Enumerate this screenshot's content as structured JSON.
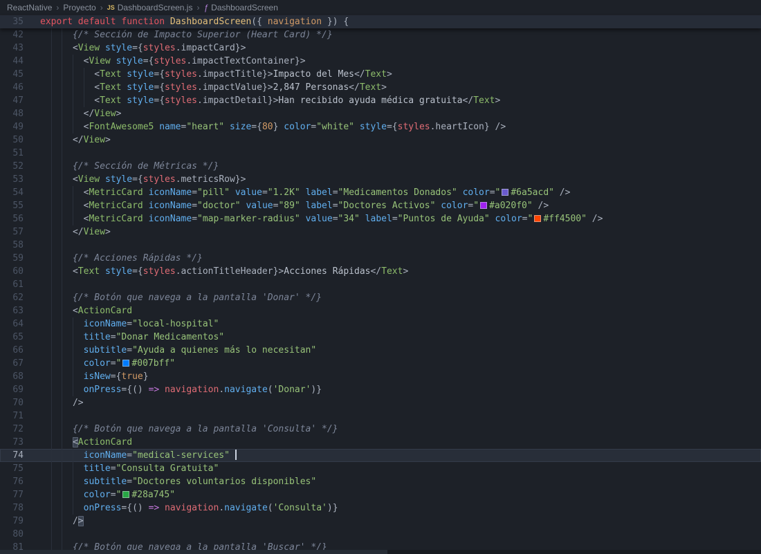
{
  "breadcrumb": {
    "separator": "›",
    "icons": {
      "js": "JS",
      "function": "ƒ"
    },
    "items": [
      {
        "label": "ReactNative"
      },
      {
        "label": "Proyecto"
      },
      {
        "label": "DashboardScreen.js",
        "icon": "js"
      },
      {
        "label": "DashboardScreen",
        "icon": "function"
      }
    ]
  },
  "editor": {
    "current_line": 74,
    "swatch_colors": [
      "#6a5acd",
      "#a020f0",
      "#ff4500",
      "#007bff",
      "#28a745"
    ],
    "sticky_line": {
      "num": 35,
      "tokens": [
        [
          "k",
          "export"
        ],
        [
          "p",
          " "
        ],
        [
          "k",
          "default"
        ],
        [
          "p",
          " "
        ],
        [
          "k",
          "function"
        ],
        [
          "p",
          " "
        ],
        [
          "f",
          "DashboardScreen"
        ],
        [
          "p",
          "({ "
        ],
        [
          "m",
          "navigation"
        ],
        [
          "p",
          " }) {"
        ]
      ]
    },
    "lines": [
      {
        "num": 42,
        "tokens": [
          [
            "c",
            "      {/* Sección de Impacto Superior (Heart Card) */}"
          ]
        ]
      },
      {
        "num": 43,
        "tokens": [
          [
            "p",
            "      <"
          ],
          [
            "t",
            "View"
          ],
          [
            "p",
            " "
          ],
          [
            "a",
            "style"
          ],
          [
            "p",
            "={"
          ],
          [
            "v",
            "styles"
          ],
          [
            "p",
            ".impactCard"
          ],
          [
            "p",
            "}>"
          ]
        ]
      },
      {
        "num": 44,
        "tokens": [
          [
            "p",
            "        <"
          ],
          [
            "t",
            "View"
          ],
          [
            "p",
            " "
          ],
          [
            "a",
            "style"
          ],
          [
            "p",
            "={"
          ],
          [
            "v",
            "styles"
          ],
          [
            "p",
            ".impactTextContainer"
          ],
          [
            "p",
            "}>"
          ]
        ]
      },
      {
        "num": 45,
        "tokens": [
          [
            "p",
            "          <"
          ],
          [
            "t",
            "Text"
          ],
          [
            "p",
            " "
          ],
          [
            "a",
            "style"
          ],
          [
            "p",
            "={"
          ],
          [
            "v",
            "styles"
          ],
          [
            "p",
            ".impactTitle"
          ],
          [
            "p",
            "}>"
          ],
          [
            "x",
            "Impacto del Mes"
          ],
          [
            "p",
            "</"
          ],
          [
            "t",
            "Text"
          ],
          [
            "p",
            ">"
          ]
        ]
      },
      {
        "num": 46,
        "tokens": [
          [
            "p",
            "          <"
          ],
          [
            "t",
            "Text"
          ],
          [
            "p",
            " "
          ],
          [
            "a",
            "style"
          ],
          [
            "p",
            "={"
          ],
          [
            "v",
            "styles"
          ],
          [
            "p",
            ".impactValue"
          ],
          [
            "p",
            "}>"
          ],
          [
            "x",
            "2,847 Personas"
          ],
          [
            "p",
            "</"
          ],
          [
            "t",
            "Text"
          ],
          [
            "p",
            ">"
          ]
        ]
      },
      {
        "num": 47,
        "tokens": [
          [
            "p",
            "          <"
          ],
          [
            "t",
            "Text"
          ],
          [
            "p",
            " "
          ],
          [
            "a",
            "style"
          ],
          [
            "p",
            "={"
          ],
          [
            "v",
            "styles"
          ],
          [
            "p",
            ".impactDetail"
          ],
          [
            "p",
            "}>"
          ],
          [
            "x",
            "Han recibido ayuda médica gratuita"
          ],
          [
            "p",
            "</"
          ],
          [
            "t",
            "Text"
          ],
          [
            "p",
            ">"
          ]
        ]
      },
      {
        "num": 48,
        "tokens": [
          [
            "p",
            "        </"
          ],
          [
            "t",
            "View"
          ],
          [
            "p",
            ">"
          ]
        ]
      },
      {
        "num": 49,
        "tokens": [
          [
            "p",
            "        <"
          ],
          [
            "t",
            "FontAwesome5"
          ],
          [
            "p",
            " "
          ],
          [
            "a",
            "name"
          ],
          [
            "p",
            "="
          ],
          [
            "s",
            "\"heart\""
          ],
          [
            "p",
            " "
          ],
          [
            "a",
            "size"
          ],
          [
            "p",
            "={"
          ],
          [
            "m",
            "80"
          ],
          [
            "p",
            "} "
          ],
          [
            "a",
            "color"
          ],
          [
            "p",
            "="
          ],
          [
            "s",
            "\"white\""
          ],
          [
            "p",
            " "
          ],
          [
            "a",
            "style"
          ],
          [
            "p",
            "={"
          ],
          [
            "v",
            "styles"
          ],
          [
            "p",
            ".heartIcon"
          ],
          [
            "p",
            "} />"
          ]
        ]
      },
      {
        "num": 50,
        "tokens": [
          [
            "p",
            "      </"
          ],
          [
            "t",
            "View"
          ],
          [
            "p",
            ">"
          ]
        ]
      },
      {
        "num": 51,
        "tokens": []
      },
      {
        "num": 52,
        "tokens": [
          [
            "c",
            "      {/* Sección de Métricas */}"
          ]
        ]
      },
      {
        "num": 53,
        "tokens": [
          [
            "p",
            "      <"
          ],
          [
            "t",
            "View"
          ],
          [
            "p",
            " "
          ],
          [
            "a",
            "style"
          ],
          [
            "p",
            "={"
          ],
          [
            "v",
            "styles"
          ],
          [
            "p",
            ".metricsRow"
          ],
          [
            "p",
            "}>"
          ]
        ]
      },
      {
        "num": 54,
        "tokens": [
          [
            "p",
            "        <"
          ],
          [
            "t",
            "MetricCard"
          ],
          [
            "p",
            " "
          ],
          [
            "a",
            "iconName"
          ],
          [
            "p",
            "="
          ],
          [
            "s",
            "\"pill\""
          ],
          [
            "p",
            " "
          ],
          [
            "a",
            "value"
          ],
          [
            "p",
            "="
          ],
          [
            "s",
            "\"1.2K\""
          ],
          [
            "p",
            " "
          ],
          [
            "a",
            "label"
          ],
          [
            "p",
            "="
          ],
          [
            "s",
            "\"Medicamentos Donados\""
          ],
          [
            "p",
            " "
          ],
          [
            "a",
            "color"
          ],
          [
            "p",
            "="
          ],
          [
            "s",
            "\""
          ],
          [
            "sw",
            "#6a5acd"
          ],
          [
            "s",
            "#6a5acd\""
          ],
          [
            "p",
            " />"
          ]
        ]
      },
      {
        "num": 55,
        "tokens": [
          [
            "p",
            "        <"
          ],
          [
            "t",
            "MetricCard"
          ],
          [
            "p",
            " "
          ],
          [
            "a",
            "iconName"
          ],
          [
            "p",
            "="
          ],
          [
            "s",
            "\"doctor\""
          ],
          [
            "p",
            " "
          ],
          [
            "a",
            "value"
          ],
          [
            "p",
            "="
          ],
          [
            "s",
            "\"89\""
          ],
          [
            "p",
            " "
          ],
          [
            "a",
            "label"
          ],
          [
            "p",
            "="
          ],
          [
            "s",
            "\"Doctores Activos\""
          ],
          [
            "p",
            " "
          ],
          [
            "a",
            "color"
          ],
          [
            "p",
            "="
          ],
          [
            "s",
            "\""
          ],
          [
            "sw",
            "#a020f0"
          ],
          [
            "s",
            "#a020f0\""
          ],
          [
            "p",
            " />"
          ]
        ]
      },
      {
        "num": 56,
        "tokens": [
          [
            "p",
            "        <"
          ],
          [
            "t",
            "MetricCard"
          ],
          [
            "p",
            " "
          ],
          [
            "a",
            "iconName"
          ],
          [
            "p",
            "="
          ],
          [
            "s",
            "\"map-marker-radius\""
          ],
          [
            "p",
            " "
          ],
          [
            "a",
            "value"
          ],
          [
            "p",
            "="
          ],
          [
            "s",
            "\"34\""
          ],
          [
            "p",
            " "
          ],
          [
            "a",
            "label"
          ],
          [
            "p",
            "="
          ],
          [
            "s",
            "\"Puntos de Ayuda\""
          ],
          [
            "p",
            " "
          ],
          [
            "a",
            "color"
          ],
          [
            "p",
            "="
          ],
          [
            "s",
            "\""
          ],
          [
            "sw",
            "#ff4500"
          ],
          [
            "s",
            "#ff4500\""
          ],
          [
            "p",
            " />"
          ]
        ]
      },
      {
        "num": 57,
        "tokens": [
          [
            "p",
            "      </"
          ],
          [
            "t",
            "View"
          ],
          [
            "p",
            ">"
          ]
        ]
      },
      {
        "num": 58,
        "tokens": []
      },
      {
        "num": 59,
        "tokens": [
          [
            "c",
            "      {/* Acciones Rápidas */}"
          ]
        ]
      },
      {
        "num": 60,
        "tokens": [
          [
            "p",
            "      <"
          ],
          [
            "t",
            "Text"
          ],
          [
            "p",
            " "
          ],
          [
            "a",
            "style"
          ],
          [
            "p",
            "={"
          ],
          [
            "v",
            "styles"
          ],
          [
            "p",
            ".actionTitleHeader"
          ],
          [
            "p",
            "}>"
          ],
          [
            "x",
            "Acciones Rápidas"
          ],
          [
            "p",
            "</"
          ],
          [
            "t",
            "Text"
          ],
          [
            "p",
            ">"
          ]
        ]
      },
      {
        "num": 61,
        "tokens": []
      },
      {
        "num": 62,
        "tokens": [
          [
            "c",
            "      {/* Botón que navega a la pantalla 'Donar' */}"
          ]
        ]
      },
      {
        "num": 63,
        "tokens": [
          [
            "p",
            "      <"
          ],
          [
            "t",
            "ActionCard"
          ]
        ]
      },
      {
        "num": 64,
        "tokens": [
          [
            "p",
            "        "
          ],
          [
            "a",
            "iconName"
          ],
          [
            "p",
            "="
          ],
          [
            "s",
            "\"local-hospital\""
          ]
        ]
      },
      {
        "num": 65,
        "tokens": [
          [
            "p",
            "        "
          ],
          [
            "a",
            "title"
          ],
          [
            "p",
            "="
          ],
          [
            "s",
            "\"Donar Medicamentos\""
          ]
        ]
      },
      {
        "num": 66,
        "tokens": [
          [
            "p",
            "        "
          ],
          [
            "a",
            "subtitle"
          ],
          [
            "p",
            "="
          ],
          [
            "s",
            "\"Ayuda a quienes más lo necesitan\""
          ]
        ]
      },
      {
        "num": 67,
        "tokens": [
          [
            "p",
            "        "
          ],
          [
            "a",
            "color"
          ],
          [
            "p",
            "="
          ],
          [
            "s",
            "\""
          ],
          [
            "sw",
            "#007bff"
          ],
          [
            "s",
            "#007bff\""
          ]
        ]
      },
      {
        "num": 68,
        "tokens": [
          [
            "p",
            "        "
          ],
          [
            "a",
            "isNew"
          ],
          [
            "p",
            "={"
          ],
          [
            "m",
            "true"
          ],
          [
            "p",
            "}"
          ]
        ]
      },
      {
        "num": 69,
        "tokens": [
          [
            "p",
            "        "
          ],
          [
            "a",
            "onPress"
          ],
          [
            "p",
            "={() "
          ],
          [
            "o",
            "=>"
          ],
          [
            "p",
            " "
          ],
          [
            "v",
            "navigation"
          ],
          [
            "p",
            "."
          ],
          [
            "b",
            "navigate"
          ],
          [
            "p",
            "("
          ],
          [
            "s",
            "'Donar'"
          ],
          [
            "p",
            ")}"
          ]
        ]
      },
      {
        "num": 70,
        "tokens": [
          [
            "p",
            "      />"
          ]
        ]
      },
      {
        "num": 71,
        "tokens": []
      },
      {
        "num": 72,
        "tokens": [
          [
            "c",
            "      {/* Botón que navega a la pantalla 'Consulta' */}"
          ]
        ]
      },
      {
        "num": 73,
        "tokens": [
          [
            "p",
            "      "
          ],
          [
            "p bm",
            "<"
          ],
          [
            "t",
            "ActionCard"
          ]
        ]
      },
      {
        "num": 74,
        "current": true,
        "tokens": [
          [
            "p",
            "        "
          ],
          [
            "a",
            "iconName"
          ],
          [
            "p",
            "="
          ],
          [
            "s",
            "\"medical-services\""
          ],
          [
            "p",
            " "
          ],
          [
            "cur",
            ""
          ]
        ]
      },
      {
        "num": 75,
        "tokens": [
          [
            "p",
            "        "
          ],
          [
            "a",
            "title"
          ],
          [
            "p",
            "="
          ],
          [
            "s",
            "\"Consulta Gratuita\""
          ]
        ]
      },
      {
        "num": 76,
        "tokens": [
          [
            "p",
            "        "
          ],
          [
            "a",
            "subtitle"
          ],
          [
            "p",
            "="
          ],
          [
            "s",
            "\"Doctores voluntarios disponibles\""
          ]
        ]
      },
      {
        "num": 77,
        "tokens": [
          [
            "p",
            "        "
          ],
          [
            "a",
            "color"
          ],
          [
            "p",
            "="
          ],
          [
            "s",
            "\""
          ],
          [
            "sw",
            "#28a745"
          ],
          [
            "s",
            "#28a745\""
          ]
        ]
      },
      {
        "num": 78,
        "tokens": [
          [
            "p",
            "        "
          ],
          [
            "a",
            "onPress"
          ],
          [
            "p",
            "={() "
          ],
          [
            "o",
            "=>"
          ],
          [
            "p",
            " "
          ],
          [
            "v",
            "navigation"
          ],
          [
            "p",
            "."
          ],
          [
            "b",
            "navigate"
          ],
          [
            "p",
            "("
          ],
          [
            "s",
            "'Consulta'"
          ],
          [
            "p",
            ")}"
          ]
        ]
      },
      {
        "num": 79,
        "tokens": [
          [
            "p",
            "      /"
          ],
          [
            "p bm",
            ">"
          ]
        ]
      },
      {
        "num": 80,
        "tokens": []
      },
      {
        "num": 81,
        "tokens": [
          [
            "c",
            "      {/* Botón que navega a la pantalla 'Buscar' */}"
          ]
        ]
      }
    ]
  }
}
